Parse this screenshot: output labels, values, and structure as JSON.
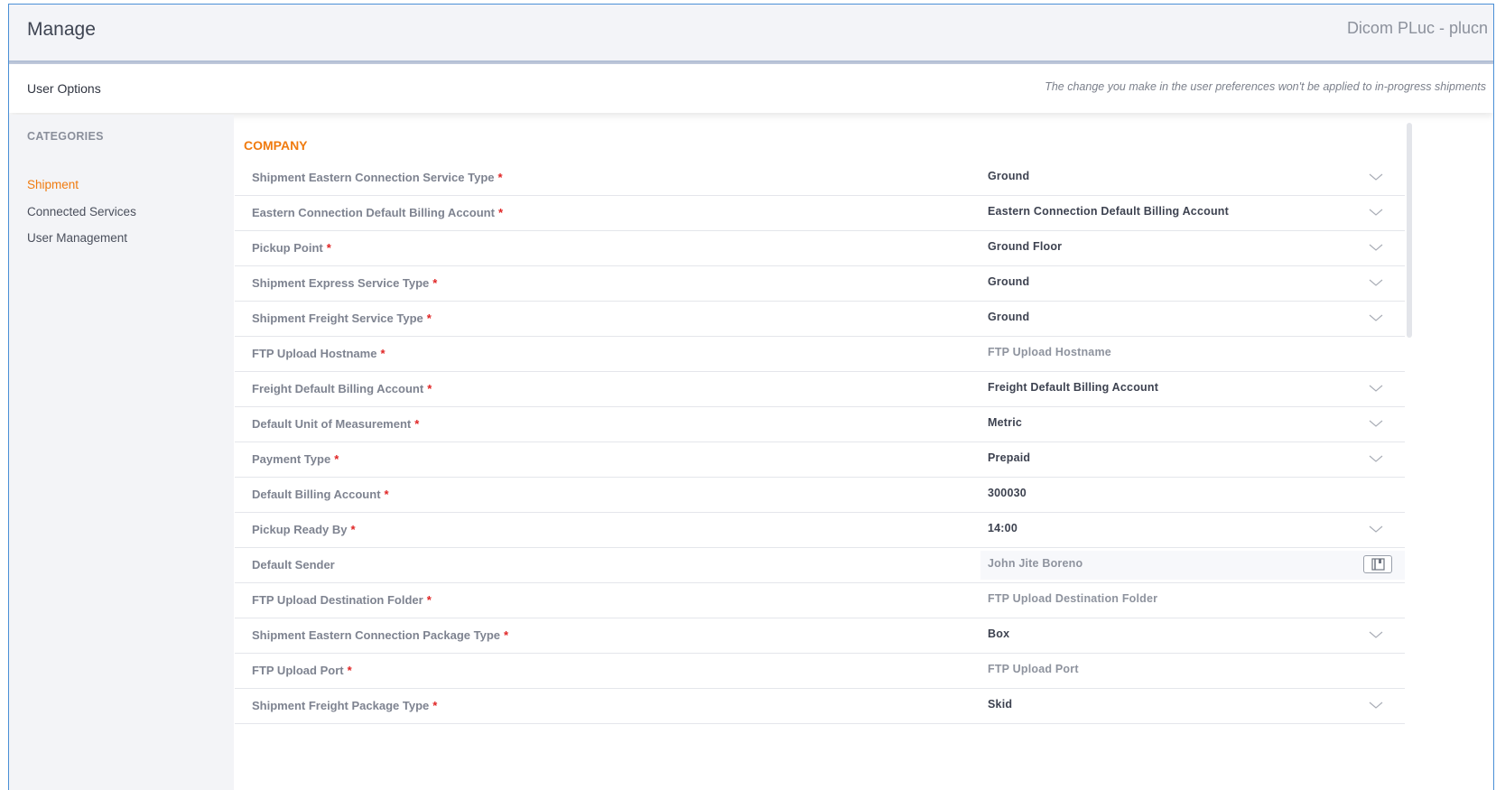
{
  "header": {
    "title": "Manage",
    "user": "Dicom PLuc - plucn"
  },
  "subheader": {
    "label": "User Options",
    "note": "The change you make in the user preferences won't be applied to in-progress shipments"
  },
  "sidebar": {
    "title": "CATEGORIES",
    "items": [
      {
        "label": "Shipment",
        "active": true
      },
      {
        "label": "Connected Services",
        "active": false
      },
      {
        "label": "User Management",
        "active": false
      }
    ]
  },
  "section": {
    "title": "COMPANY"
  },
  "required_marker": "*",
  "rows": [
    {
      "label": "Shipment Eastern Connection Service Type",
      "value": "Ground"
    },
    {
      "label": "Eastern Connection Default Billing Account",
      "value": "Eastern Connection Default Billing Account"
    },
    {
      "label": "Pickup Point",
      "value": "Ground Floor"
    },
    {
      "label": "Shipment Express Service Type",
      "value": "Ground"
    },
    {
      "label": "Shipment Freight Service Type",
      "value": "Ground"
    },
    {
      "label": "FTP Upload Hostname",
      "value": "FTP Upload Hostname"
    },
    {
      "label": "Freight Default Billing Account",
      "value": "Freight Default Billing Account"
    },
    {
      "label": "Default Unit of Measurement",
      "value": "Metric"
    },
    {
      "label": "Payment Type",
      "value": "Prepaid"
    },
    {
      "label": "Default Billing Account",
      "value": "300030"
    },
    {
      "label": "Pickup Ready By",
      "value": "14:00"
    },
    {
      "label": "Default Sender",
      "value": "John Jite Boreno"
    },
    {
      "label": "FTP Upload Destination Folder",
      "value": "FTP Upload Destination Folder"
    },
    {
      "label": "Shipment Eastern Connection Package Type",
      "value": "Box"
    },
    {
      "label": "FTP Upload Port",
      "value": "FTP Upload Port"
    },
    {
      "label": "Shipment Freight Package Type",
      "value": "Skid"
    }
  ],
  "colors": {
    "accent": "#f07b0f",
    "required": "#e02424",
    "frame": "#4a8fd6"
  }
}
